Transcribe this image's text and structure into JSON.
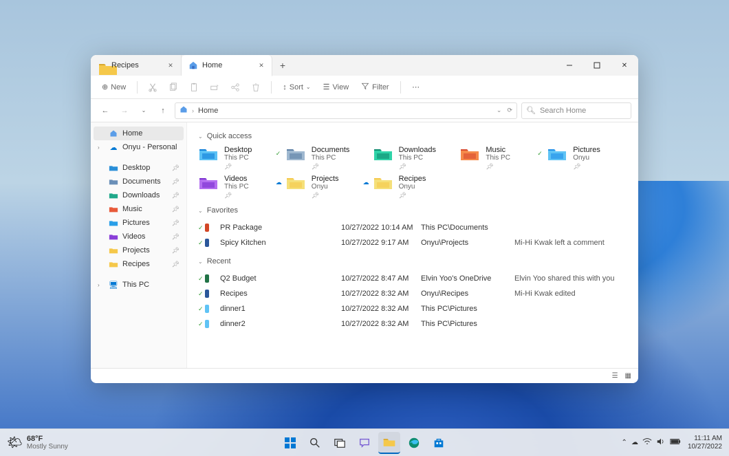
{
  "tabs": [
    {
      "label": "Recipes",
      "active": false
    },
    {
      "label": "Home",
      "active": true
    }
  ],
  "toolbar": {
    "new": "New",
    "sort": "Sort",
    "view": "View",
    "filter": "Filter"
  },
  "breadcrumb": {
    "home": "Home"
  },
  "search": {
    "placeholder": "Search Home"
  },
  "sidebar": {
    "home": "Home",
    "onedrive": "Onyu - Personal",
    "items": [
      {
        "label": "Desktop"
      },
      {
        "label": "Documents"
      },
      {
        "label": "Downloads"
      },
      {
        "label": "Music"
      },
      {
        "label": "Pictures"
      },
      {
        "label": "Videos"
      },
      {
        "label": "Projects"
      },
      {
        "label": "Recipes"
      }
    ],
    "thispc": "This PC"
  },
  "sections": {
    "quick_access": "Quick access",
    "favorites": "Favorites",
    "recent": "Recent"
  },
  "quick_access": [
    {
      "name": "Desktop",
      "sub": "This PC",
      "color1": "#0f7fd8",
      "color2": "#5ac1f5",
      "badge": false
    },
    {
      "name": "Documents",
      "sub": "This PC",
      "color1": "#5c7fa5",
      "color2": "#9fb8d0",
      "badge": true
    },
    {
      "name": "Downloads",
      "sub": "This PC",
      "color1": "#0d8c6f",
      "color2": "#2fd3a8",
      "badge": false
    },
    {
      "name": "Music",
      "sub": "This PC",
      "color1": "#d84a2e",
      "color2": "#f58a4a",
      "badge": false
    },
    {
      "name": "Pictures",
      "sub": "Onyu",
      "color1": "#1f8fe8",
      "color2": "#5fc3f5",
      "badge": true
    },
    {
      "name": "Videos",
      "sub": "This PC",
      "color1": "#7a2fd0",
      "color2": "#b46ff0",
      "badge": false
    },
    {
      "name": "Projects",
      "sub": "Onyu",
      "color1": "#f5c84a",
      "color2": "#f5e07a",
      "badge": false,
      "cloud": true
    },
    {
      "name": "Recipes",
      "sub": "Onyu",
      "color1": "#f5c84a",
      "color2": "#f5e07a",
      "badge": false,
      "cloud": true
    }
  ],
  "favorites": [
    {
      "name": "PR Package",
      "date": "10/27/2022 10:14 AM",
      "path": "This PC\\Documents",
      "activity": "",
      "icon": "#d24726"
    },
    {
      "name": "Spicy Kitchen",
      "date": "10/27/2022 9:17 AM",
      "path": "Onyu\\Projects",
      "activity": "Mi-Hi Kwak left a comment",
      "icon": "#2b579a"
    }
  ],
  "recent": [
    {
      "name": "Q2 Budget",
      "date": "10/27/2022 8:47 AM",
      "path": "Elvin Yoo's OneDrive",
      "activity": "Elvin Yoo shared this with you",
      "icon": "#217346"
    },
    {
      "name": "Recipes",
      "date": "10/27/2022 8:32 AM",
      "path": "Onyu\\Recipes",
      "activity": "Mi-Hi Kwak edited",
      "icon": "#2b579a"
    },
    {
      "name": "dinner1",
      "date": "10/27/2022 8:32 AM",
      "path": "This PC\\Pictures",
      "activity": "",
      "icon": "#5fc3f5"
    },
    {
      "name": "dinner2",
      "date": "10/27/2022 8:32 AM",
      "path": "This PC\\Pictures",
      "activity": "",
      "icon": "#5fc3f5"
    }
  ],
  "taskbar": {
    "temp": "68°F",
    "condition": "Mostly Sunny",
    "time": "11:11 AM",
    "date": "10/27/2022"
  }
}
